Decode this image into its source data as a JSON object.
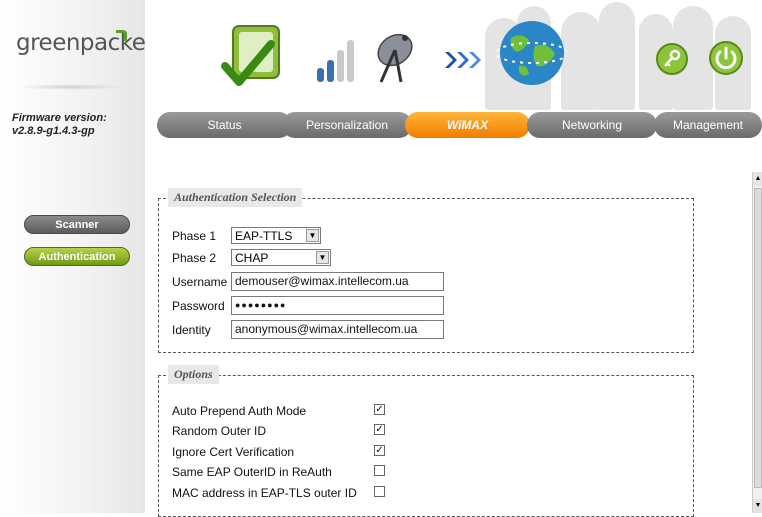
{
  "brand": {
    "logo_text": "greenpacket"
  },
  "firmware": {
    "label": "Firmware version:",
    "value": "v2.8.9-g1.4.3-gp"
  },
  "sidebar": {
    "buttons": [
      {
        "label": "Scanner",
        "active": false
      },
      {
        "label": "Authentication",
        "active": true
      }
    ]
  },
  "tabs": [
    {
      "label": "Status",
      "active": false
    },
    {
      "label": "Personalization",
      "active": false
    },
    {
      "label": "WiMAX",
      "active": true
    },
    {
      "label": "Networking",
      "active": false
    },
    {
      "label": "Management",
      "active": false
    }
  ],
  "auth_section": {
    "legend": "Authentication Selection",
    "phase1_label": "Phase 1",
    "phase1_value": "EAP-TTLS",
    "phase2_label": "Phase 2",
    "phase2_value": "CHAP",
    "username_label": "Username",
    "username_value": "demouser@wimax.intellecom.ua",
    "password_label": "Password",
    "password_value": "●●●●●●●●",
    "identity_label": "Identity",
    "identity_value": "anonymous@wimax.intellecom.ua"
  },
  "options_section": {
    "legend": "Options",
    "items": [
      {
        "label": "Auto Prepend Auth Mode",
        "checked": true
      },
      {
        "label": "Random Outer ID",
        "checked": true
      },
      {
        "label": "Ignore Cert Verification",
        "checked": true
      },
      {
        "label": "Same EAP OuterID in ReAuth",
        "checked": false
      },
      {
        "label": "MAC address in EAP-TLS outer ID",
        "checked": false
      }
    ]
  },
  "colors": {
    "active_tab": "#f48a10",
    "inactive_tab": "#7f7f7f",
    "active_sidebar": "#8ab022",
    "inactive_sidebar": "#6b6b6b"
  },
  "icons": {
    "header": [
      "checkmark-box-icon",
      "signal-bars-icon",
      "satellite-dish-icon",
      "arrows-icon",
      "globe-icon",
      "key-icon",
      "power-icon"
    ]
  }
}
